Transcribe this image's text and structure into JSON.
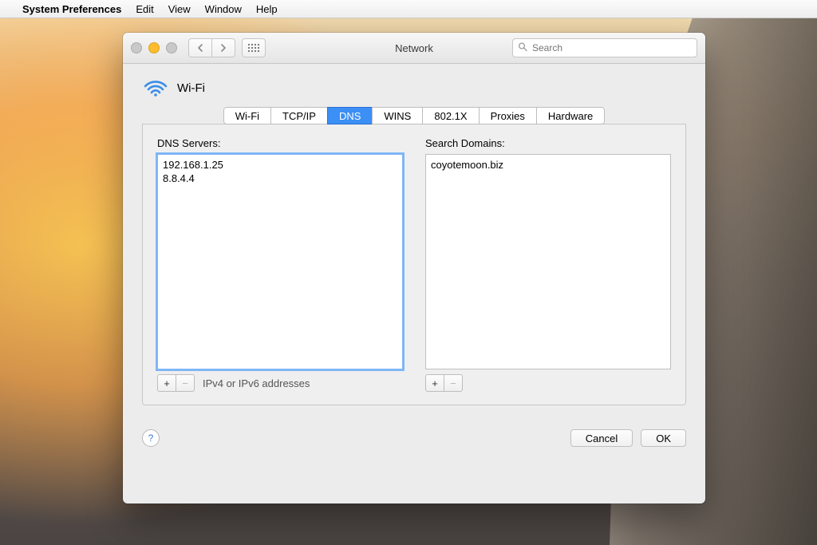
{
  "menubar": {
    "app_name": "System Preferences",
    "items": [
      "Edit",
      "View",
      "Window",
      "Help"
    ]
  },
  "window": {
    "title": "Network",
    "search_placeholder": "Search"
  },
  "header": {
    "interface_name": "Wi-Fi"
  },
  "tabs": [
    "Wi-Fi",
    "TCP/IP",
    "DNS",
    "WINS",
    "802.1X",
    "Proxies",
    "Hardware"
  ],
  "tabs_selected_index": 2,
  "dns": {
    "servers_label": "DNS Servers:",
    "servers": [
      "192.168.1.25",
      "8.8.4.4"
    ],
    "hint": "IPv4 or IPv6 addresses",
    "domains_label": "Search Domains:",
    "domains": [
      "coyotemoon.biz"
    ]
  },
  "buttons": {
    "cancel": "Cancel",
    "ok": "OK"
  }
}
